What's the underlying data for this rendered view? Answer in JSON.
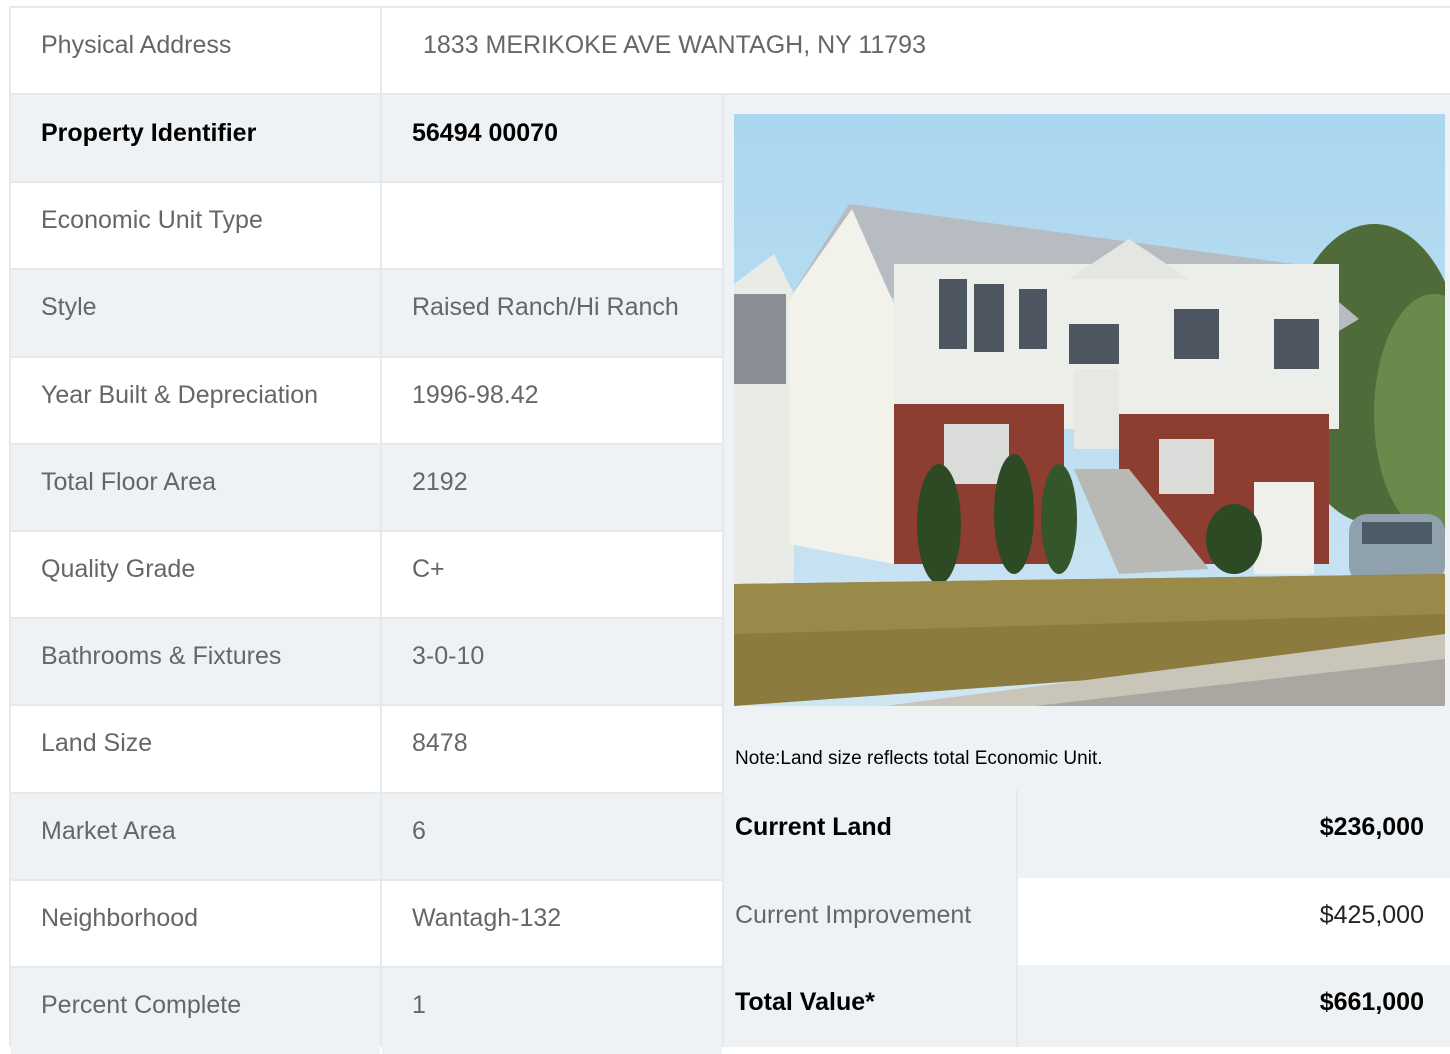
{
  "address": {
    "label": "Physical Address",
    "value": "1833  MERIKOKE AVE  WANTAGH, NY  11793"
  },
  "details": [
    {
      "label": "Property Identifier",
      "value": "56494  00070",
      "bold": true
    },
    {
      "label": "Economic Unit Type",
      "value": ""
    },
    {
      "label": "Style",
      "value": "Raised Ranch/Hi Ranch"
    },
    {
      "label": "Year Built & Depreciation",
      "value": "1996-98.42"
    },
    {
      "label": "Total Floor Area",
      "value": "2192"
    },
    {
      "label": "Quality Grade",
      "value": "C+"
    },
    {
      "label": "Bathrooms & Fixtures",
      "value": "3-0-10"
    },
    {
      "label": "Land Size",
      "value": "8478"
    },
    {
      "label": "Market Area",
      "value": "6"
    },
    {
      "label": "Neighborhood",
      "value": "Wantagh-132"
    },
    {
      "label": "Percent Complete",
      "value": "1"
    }
  ],
  "note": "Note:Land size reflects total Economic Unit.",
  "values": [
    {
      "label": "Current Land",
      "value": "$236,000"
    },
    {
      "label": "Current Improvement",
      "value": "$425,000"
    },
    {
      "label": "Total Value*",
      "value": "$661,000"
    }
  ],
  "photo": {
    "icon": "house-photo"
  },
  "colors": {
    "shaded": "#eff2f5",
    "border": "#e6e9ec"
  }
}
